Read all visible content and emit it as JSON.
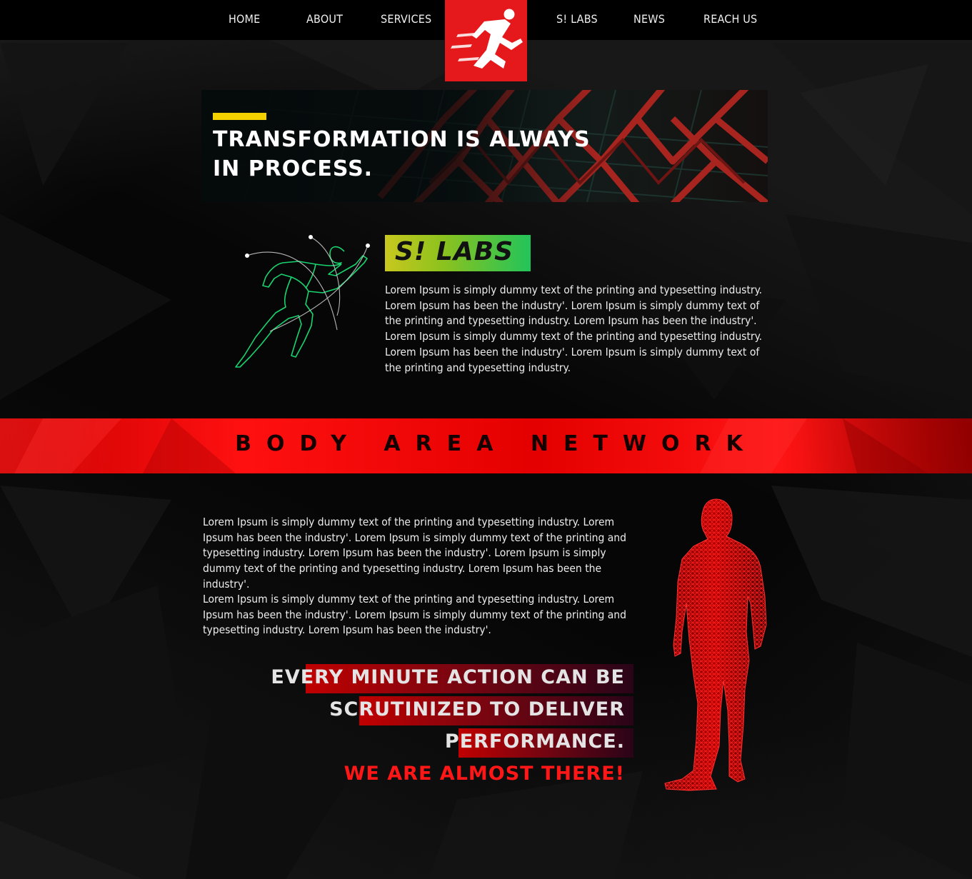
{
  "nav": {
    "items": [
      {
        "label": "HOME"
      },
      {
        "label": "ABOUT"
      },
      {
        "label": "SERVICES"
      },
      {
        "label": "S! LABS"
      },
      {
        "label": "NEWS"
      },
      {
        "label": "REACH US"
      }
    ],
    "logo_icon": "running-man-icon",
    "logo_color": "#e5181c"
  },
  "hero": {
    "line1": "TRANSFORMATION IS ALWAYS",
    "line2": "IN PROCESS.",
    "accent_color": "#f5d000"
  },
  "labs": {
    "title": "S! LABS",
    "illustration_icon": "sprinter-outline-icon",
    "text": "Lorem Ipsum is simply dummy text of the printing and typesetting industry. Lorem Ipsum has been the industry'. Lorem Ipsum is simply dummy text of the printing and typesetting industry. Lorem Ipsum has been the industry'. Lorem Ipsum is simply dummy text of the printing and typesetting industry. Lorem Ipsum has been the industry'. Lorem Ipsum is simply dummy text of the printing and typesetting industry."
  },
  "ban": {
    "title": "BODY AREA NETWORK",
    "paragraph1": "Lorem Ipsum is simply dummy text of the printing and typesetting industry. Lorem Ipsum has been the industry'. Lorem Ipsum is simply dummy text of the printing and typesetting industry. Lorem Ipsum has been the industry'. Lorem Ipsum is simply dummy text of the printing and typesetting industry. Lorem Ipsum has been the industry'.",
    "paragraph2": "Lorem Ipsum is simply dummy text of the printing and typesetting industry. Lorem Ipsum has been the industry'. Lorem Ipsum is simply dummy text of the printing and typesetting industry. Lorem Ipsum has been the industry'.",
    "figure_icon": "wireframe-human-icon",
    "accent_color": "#ff1010"
  },
  "tagline": {
    "line1": "EVERY MINUTE ACTION CAN BE",
    "line2": "SCRUTINIZED TO DELIVER",
    "line3": "PERFORMANCE.",
    "line4": "WE ARE ALMOST THERE!"
  }
}
